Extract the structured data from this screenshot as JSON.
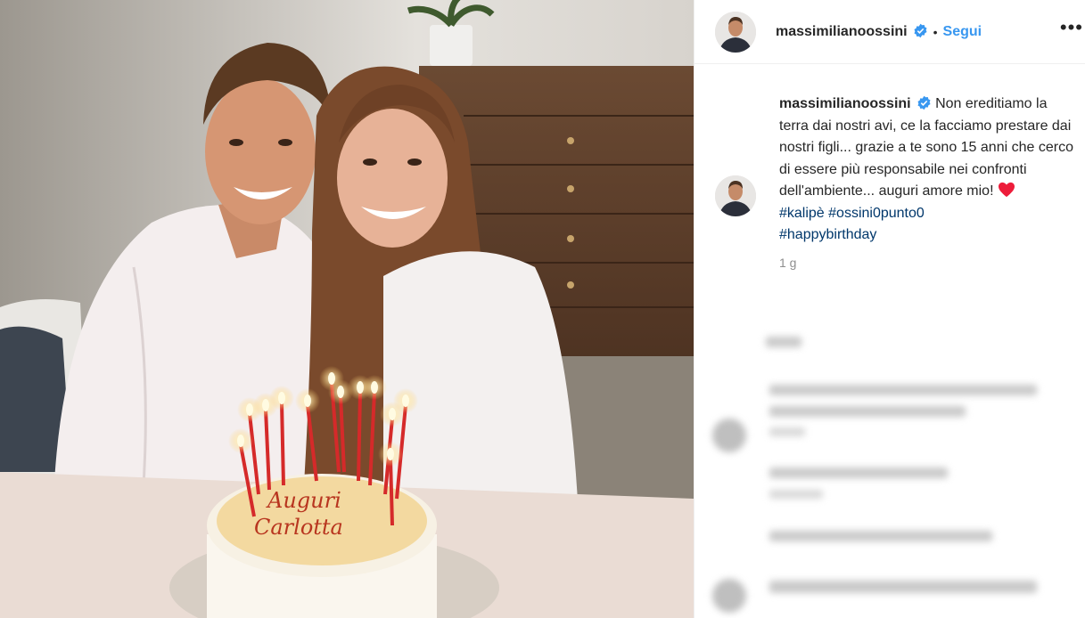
{
  "post": {
    "username": "massimilianoossini",
    "follow_label": "Segui",
    "separator": "•",
    "more_label": "•••",
    "caption_username": "massimilianoossini",
    "caption_text": "Non ereditiamo la terra dai nostri avi, ce la facciamo prestare dai nostri figli... grazie a te sono 15 anni che cerco di essere più responsabile nei confronti dell'ambiente... auguri amore mio!",
    "hashtags": [
      "#kalipè #ossini0punto0",
      "#happybirthday"
    ],
    "time_ago": "1 g",
    "cake_text": [
      "Auguri",
      "Carlotta"
    ]
  },
  "icons": {
    "verified": "verified-badge-icon",
    "heart": "red-heart-emoji",
    "more": "more-options-icon"
  },
  "colors": {
    "link_blue": "#3897f0",
    "hashtag": "#00376b",
    "verified": "#3897f0",
    "heart": "#ed1c3a",
    "muted": "#8e8e8e"
  }
}
